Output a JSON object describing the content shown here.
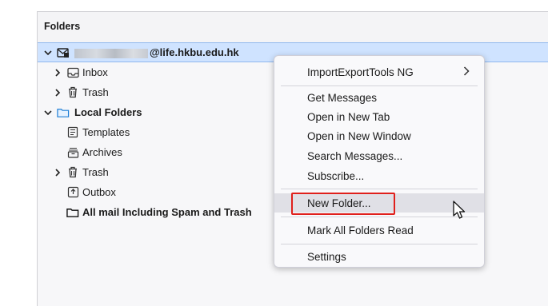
{
  "pane": {
    "title": "Folders"
  },
  "account": {
    "name_suffix": "@life.hkbu.edu.hk"
  },
  "tree": {
    "inbox": "Inbox",
    "trash": "Trash",
    "local_folders": "Local Folders",
    "templates": "Templates",
    "archives": "Archives",
    "local_trash": "Trash",
    "outbox": "Outbox",
    "all_mail": "All mail Including Spam and Trash"
  },
  "context_menu": {
    "importexport": "ImportExportTools NG",
    "get_messages": "Get Messages",
    "open_new_tab": "Open in New Tab",
    "open_new_window": "Open in New Window",
    "search_messages": "Search Messages...",
    "subscribe": "Subscribe...",
    "new_folder": "New Folder...",
    "mark_all_read": "Mark All Folders Read",
    "settings": "Settings"
  },
  "colors": {
    "selection": "#cfe3ff",
    "highlight_border": "#e0201c",
    "menu_hover": "#e0e0e6"
  },
  "icons": [
    "chevron-down-icon",
    "chevron-right-icon",
    "account-mail-icon",
    "inbox-icon",
    "trash-icon",
    "folder-icon",
    "templates-icon",
    "archives-icon",
    "outbox-icon",
    "submenu-arrow-icon",
    "mouse-cursor-icon"
  ]
}
